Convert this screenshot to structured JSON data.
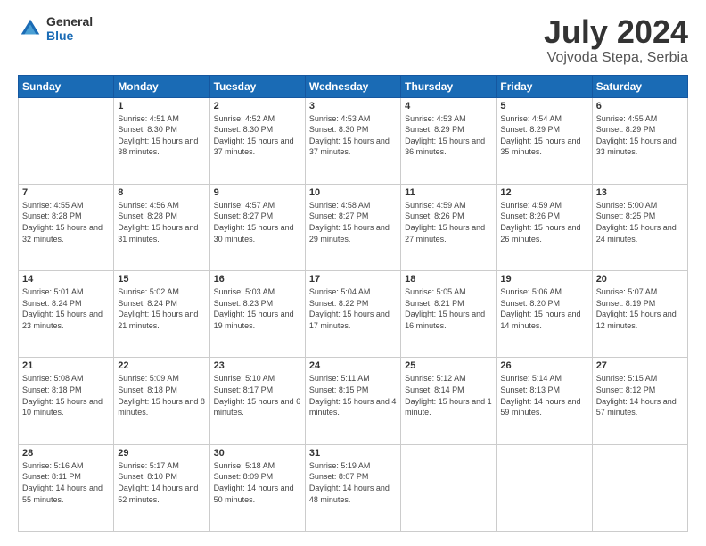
{
  "header": {
    "logo": {
      "general": "General",
      "blue": "Blue"
    },
    "title": "July 2024",
    "location": "Vojvoda Stepa, Serbia"
  },
  "weekdays": [
    "Sunday",
    "Monday",
    "Tuesday",
    "Wednesday",
    "Thursday",
    "Friday",
    "Saturday"
  ],
  "weeks": [
    [
      {
        "day": "",
        "sunrise": "",
        "sunset": "",
        "daylight": ""
      },
      {
        "day": "1",
        "sunrise": "Sunrise: 4:51 AM",
        "sunset": "Sunset: 8:30 PM",
        "daylight": "Daylight: 15 hours and 38 minutes."
      },
      {
        "day": "2",
        "sunrise": "Sunrise: 4:52 AM",
        "sunset": "Sunset: 8:30 PM",
        "daylight": "Daylight: 15 hours and 37 minutes."
      },
      {
        "day": "3",
        "sunrise": "Sunrise: 4:53 AM",
        "sunset": "Sunset: 8:30 PM",
        "daylight": "Daylight: 15 hours and 37 minutes."
      },
      {
        "day": "4",
        "sunrise": "Sunrise: 4:53 AM",
        "sunset": "Sunset: 8:29 PM",
        "daylight": "Daylight: 15 hours and 36 minutes."
      },
      {
        "day": "5",
        "sunrise": "Sunrise: 4:54 AM",
        "sunset": "Sunset: 8:29 PM",
        "daylight": "Daylight: 15 hours and 35 minutes."
      },
      {
        "day": "6",
        "sunrise": "Sunrise: 4:55 AM",
        "sunset": "Sunset: 8:29 PM",
        "daylight": "Daylight: 15 hours and 33 minutes."
      }
    ],
    [
      {
        "day": "7",
        "sunrise": "Sunrise: 4:55 AM",
        "sunset": "Sunset: 8:28 PM",
        "daylight": "Daylight: 15 hours and 32 minutes."
      },
      {
        "day": "8",
        "sunrise": "Sunrise: 4:56 AM",
        "sunset": "Sunset: 8:28 PM",
        "daylight": "Daylight: 15 hours and 31 minutes."
      },
      {
        "day": "9",
        "sunrise": "Sunrise: 4:57 AM",
        "sunset": "Sunset: 8:27 PM",
        "daylight": "Daylight: 15 hours and 30 minutes."
      },
      {
        "day": "10",
        "sunrise": "Sunrise: 4:58 AM",
        "sunset": "Sunset: 8:27 PM",
        "daylight": "Daylight: 15 hours and 29 minutes."
      },
      {
        "day": "11",
        "sunrise": "Sunrise: 4:59 AM",
        "sunset": "Sunset: 8:26 PM",
        "daylight": "Daylight: 15 hours and 27 minutes."
      },
      {
        "day": "12",
        "sunrise": "Sunrise: 4:59 AM",
        "sunset": "Sunset: 8:26 PM",
        "daylight": "Daylight: 15 hours and 26 minutes."
      },
      {
        "day": "13",
        "sunrise": "Sunrise: 5:00 AM",
        "sunset": "Sunset: 8:25 PM",
        "daylight": "Daylight: 15 hours and 24 minutes."
      }
    ],
    [
      {
        "day": "14",
        "sunrise": "Sunrise: 5:01 AM",
        "sunset": "Sunset: 8:24 PM",
        "daylight": "Daylight: 15 hours and 23 minutes."
      },
      {
        "day": "15",
        "sunrise": "Sunrise: 5:02 AM",
        "sunset": "Sunset: 8:24 PM",
        "daylight": "Daylight: 15 hours and 21 minutes."
      },
      {
        "day": "16",
        "sunrise": "Sunrise: 5:03 AM",
        "sunset": "Sunset: 8:23 PM",
        "daylight": "Daylight: 15 hours and 19 minutes."
      },
      {
        "day": "17",
        "sunrise": "Sunrise: 5:04 AM",
        "sunset": "Sunset: 8:22 PM",
        "daylight": "Daylight: 15 hours and 17 minutes."
      },
      {
        "day": "18",
        "sunrise": "Sunrise: 5:05 AM",
        "sunset": "Sunset: 8:21 PM",
        "daylight": "Daylight: 15 hours and 16 minutes."
      },
      {
        "day": "19",
        "sunrise": "Sunrise: 5:06 AM",
        "sunset": "Sunset: 8:20 PM",
        "daylight": "Daylight: 15 hours and 14 minutes."
      },
      {
        "day": "20",
        "sunrise": "Sunrise: 5:07 AM",
        "sunset": "Sunset: 8:19 PM",
        "daylight": "Daylight: 15 hours and 12 minutes."
      }
    ],
    [
      {
        "day": "21",
        "sunrise": "Sunrise: 5:08 AM",
        "sunset": "Sunset: 8:18 PM",
        "daylight": "Daylight: 15 hours and 10 minutes."
      },
      {
        "day": "22",
        "sunrise": "Sunrise: 5:09 AM",
        "sunset": "Sunset: 8:18 PM",
        "daylight": "Daylight: 15 hours and 8 minutes."
      },
      {
        "day": "23",
        "sunrise": "Sunrise: 5:10 AM",
        "sunset": "Sunset: 8:17 PM",
        "daylight": "Daylight: 15 hours and 6 minutes."
      },
      {
        "day": "24",
        "sunrise": "Sunrise: 5:11 AM",
        "sunset": "Sunset: 8:15 PM",
        "daylight": "Daylight: 15 hours and 4 minutes."
      },
      {
        "day": "25",
        "sunrise": "Sunrise: 5:12 AM",
        "sunset": "Sunset: 8:14 PM",
        "daylight": "Daylight: 15 hours and 1 minute."
      },
      {
        "day": "26",
        "sunrise": "Sunrise: 5:14 AM",
        "sunset": "Sunset: 8:13 PM",
        "daylight": "Daylight: 14 hours and 59 minutes."
      },
      {
        "day": "27",
        "sunrise": "Sunrise: 5:15 AM",
        "sunset": "Sunset: 8:12 PM",
        "daylight": "Daylight: 14 hours and 57 minutes."
      }
    ],
    [
      {
        "day": "28",
        "sunrise": "Sunrise: 5:16 AM",
        "sunset": "Sunset: 8:11 PM",
        "daylight": "Daylight: 14 hours and 55 minutes."
      },
      {
        "day": "29",
        "sunrise": "Sunrise: 5:17 AM",
        "sunset": "Sunset: 8:10 PM",
        "daylight": "Daylight: 14 hours and 52 minutes."
      },
      {
        "day": "30",
        "sunrise": "Sunrise: 5:18 AM",
        "sunset": "Sunset: 8:09 PM",
        "daylight": "Daylight: 14 hours and 50 minutes."
      },
      {
        "day": "31",
        "sunrise": "Sunrise: 5:19 AM",
        "sunset": "Sunset: 8:07 PM",
        "daylight": "Daylight: 14 hours and 48 minutes."
      },
      {
        "day": "",
        "sunrise": "",
        "sunset": "",
        "daylight": ""
      },
      {
        "day": "",
        "sunrise": "",
        "sunset": "",
        "daylight": ""
      },
      {
        "day": "",
        "sunrise": "",
        "sunset": "",
        "daylight": ""
      }
    ]
  ]
}
